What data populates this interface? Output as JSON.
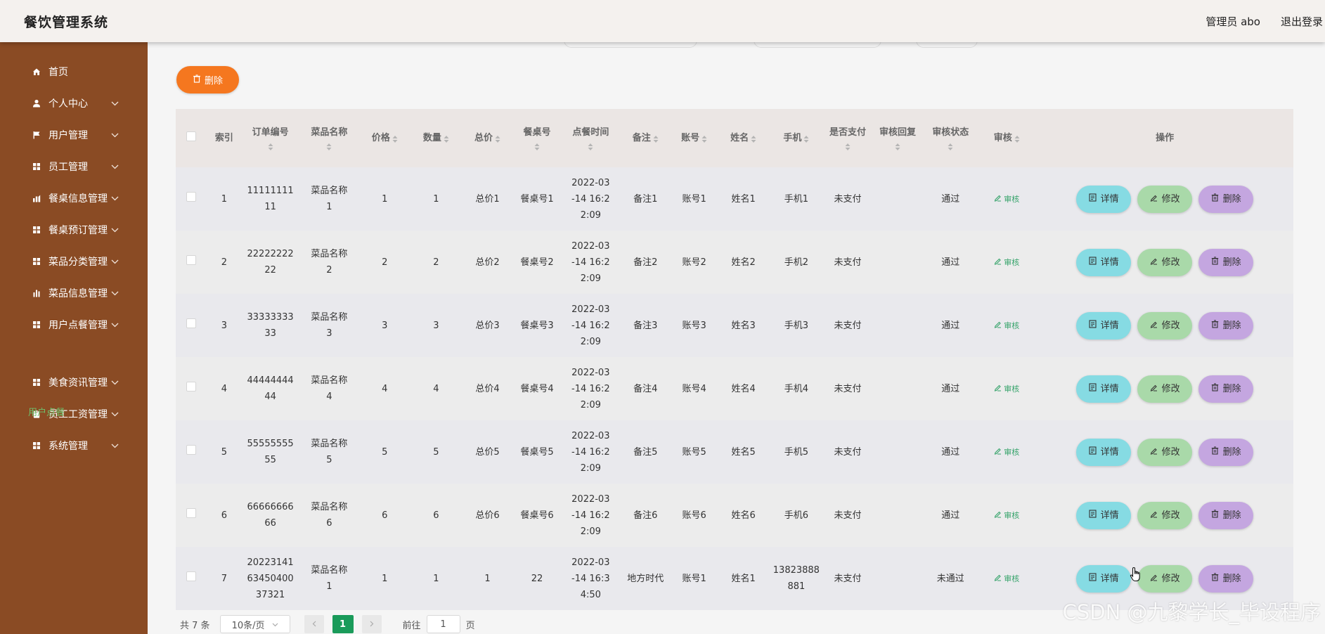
{
  "header": {
    "app_title": "餐饮管理系统",
    "user_label": "管理员 abo",
    "logout_label": "退出登录"
  },
  "sidebar": {
    "items": [
      {
        "label": "首页",
        "icon": "home-icon",
        "has_arrow": false
      },
      {
        "label": "个人中心",
        "icon": "user-icon",
        "has_arrow": true
      },
      {
        "label": "用户管理",
        "icon": "flag-icon",
        "has_arrow": true
      },
      {
        "label": "员工管理",
        "icon": "grid-icon",
        "has_arrow": true
      },
      {
        "label": "餐桌信息管理",
        "icon": "chart-icon",
        "has_arrow": true
      },
      {
        "label": "餐桌预订管理",
        "icon": "grid-icon",
        "has_arrow": true
      },
      {
        "label": "菜品分类管理",
        "icon": "grid-icon",
        "has_arrow": true
      },
      {
        "label": "菜品信息管理",
        "icon": "bar-chart-icon",
        "has_arrow": true
      },
      {
        "label": "用户点餐管理",
        "icon": "grid-icon",
        "has_arrow": true
      },
      {
        "label": "美食资讯管理",
        "icon": "grid-icon",
        "has_arrow": true
      },
      {
        "label": "员工工资管理",
        "icon": "clipboard-icon",
        "has_arrow": true
      },
      {
        "label": "系统管理",
        "icon": "grid-icon",
        "has_arrow": true
      }
    ],
    "sub_item": "用户点餐"
  },
  "toolbar": {
    "delete_label": "删除"
  },
  "table": {
    "columns": [
      "索引",
      "订单编号",
      "菜品名称",
      "价格",
      "数量",
      "总价",
      "餐桌号",
      "点餐时间",
      "备注",
      "账号",
      "姓名",
      "手机",
      "是否支付",
      "审核回复",
      "审核状态",
      "审核",
      "操作"
    ],
    "rows": [
      {
        "index": "1",
        "order_no": "1111111111",
        "dish": "菜品名称1",
        "price": "1",
        "qty": "1",
        "total": "总价1",
        "table_no": "餐桌号1",
        "time": "2022-03-14 16:22:09",
        "note": "备注1",
        "account": "账号1",
        "name": "姓名1",
        "phone": "手机1",
        "paid": "未支付",
        "reply": "",
        "status": "通过"
      },
      {
        "index": "2",
        "order_no": "2222222222",
        "dish": "菜品名称2",
        "price": "2",
        "qty": "2",
        "total": "总价2",
        "table_no": "餐桌号2",
        "time": "2022-03-14 16:22:09",
        "note": "备注2",
        "account": "账号2",
        "name": "姓名2",
        "phone": "手机2",
        "paid": "未支付",
        "reply": "",
        "status": "通过"
      },
      {
        "index": "3",
        "order_no": "3333333333",
        "dish": "菜品名称3",
        "price": "3",
        "qty": "3",
        "total": "总价3",
        "table_no": "餐桌号3",
        "time": "2022-03-14 16:22:09",
        "note": "备注3",
        "account": "账号3",
        "name": "姓名3",
        "phone": "手机3",
        "paid": "未支付",
        "reply": "",
        "status": "通过"
      },
      {
        "index": "4",
        "order_no": "4444444444",
        "dish": "菜品名称4",
        "price": "4",
        "qty": "4",
        "total": "总价4",
        "table_no": "餐桌号4",
        "time": "2022-03-14 16:22:09",
        "note": "备注4",
        "account": "账号4",
        "name": "姓名4",
        "phone": "手机4",
        "paid": "未支付",
        "reply": "",
        "status": "通过"
      },
      {
        "index": "5",
        "order_no": "5555555555",
        "dish": "菜品名称5",
        "price": "5",
        "qty": "5",
        "total": "总价5",
        "table_no": "餐桌号5",
        "time": "2022-03-14 16:22:09",
        "note": "备注5",
        "account": "账号5",
        "name": "姓名5",
        "phone": "手机5",
        "paid": "未支付",
        "reply": "",
        "status": "通过"
      },
      {
        "index": "6",
        "order_no": "6666666666",
        "dish": "菜品名称6",
        "price": "6",
        "qty": "6",
        "total": "总价6",
        "table_no": "餐桌号6",
        "time": "2022-03-14 16:22:09",
        "note": "备注6",
        "account": "账号6",
        "name": "姓名6",
        "phone": "手机6",
        "paid": "未支付",
        "reply": "",
        "status": "通过"
      },
      {
        "index": "7",
        "order_no": "2022314163450400 37321",
        "dish": "菜品名称1",
        "price": "1",
        "qty": "1",
        "total": "1",
        "table_no": "22",
        "time": "2022-03-14 16:34:50",
        "note": "地方时代",
        "account": "账号1",
        "name": "姓名1",
        "phone": "13823888881",
        "paid": "未支付",
        "reply": "",
        "status": "未通过"
      }
    ],
    "row_actions": {
      "audit": "审核",
      "detail": "详情",
      "edit": "修改",
      "delete": "删除"
    }
  },
  "pagination": {
    "total": "共 7 条",
    "page_size": "10条/页",
    "current_page": "1",
    "goto_label": "前往",
    "goto_value": "1",
    "page_suffix": "页"
  },
  "watermark": "CSDN @九黎学长_毕设程序",
  "colors": {
    "sidebar_bg": "#8a4b24",
    "delete_orange": "#f5771f",
    "detail": "#86dbe3",
    "edit": "#a9d9a9",
    "delete": "#c4a6e0",
    "page_active": "#1a9b5a"
  }
}
